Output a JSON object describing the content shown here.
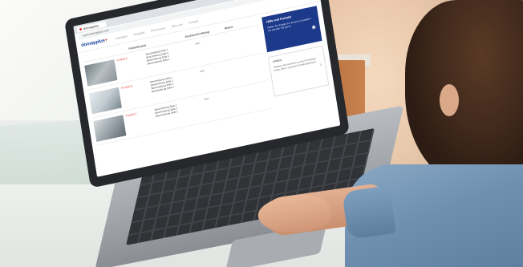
{
  "browser": {
    "tab_label": "domapplus",
    "address": "www.domapplus.com"
  },
  "site": {
    "logo_prefix": "domapplus",
    "logo_suffix": "+",
    "nav": [
      "Lösungen",
      "Produkte",
      "Referenzen",
      "Über uns",
      "Kontakt"
    ]
  },
  "table": {
    "headers": [
      "Produktname",
      "Kurzbeschreibung",
      "Status"
    ],
    "rows": [
      {
        "link": "Produkt A",
        "desc": [
          "Beschreibung Zeile 1",
          "Beschreibung Zeile 2",
          "Beschreibung Zeile 3",
          "Beschreibung Zeile 4"
        ],
        "meta": "aktiv"
      },
      {
        "link": "Produkt B",
        "desc": [
          "Beschreibung Zeile 1",
          "Beschreibung Zeile 2",
          "Beschreibung Zeile 3",
          "Beschreibung Zeile 4"
        ],
        "meta": "aktiv"
      },
      {
        "link": "Produkt C",
        "desc": [
          "Beschreibung Zeile 1",
          "Beschreibung Zeile 2",
          "Beschreibung Zeile 3"
        ],
        "meta": "aktiv"
      }
    ]
  },
  "sidebar": {
    "promo_title": "Hilfe und Kontakt",
    "promo_text": "Haben Sie Fragen zu unseren Lösungen? Wir beraten Sie gerne.",
    "info_title": "Infobox",
    "info_text": "Weitere Informationen zu den Produkten finden Sie in unserem Downloadbereich."
  },
  "colors": {
    "brand_blue": "#1d3a8a",
    "brand_red": "#e53935"
  }
}
